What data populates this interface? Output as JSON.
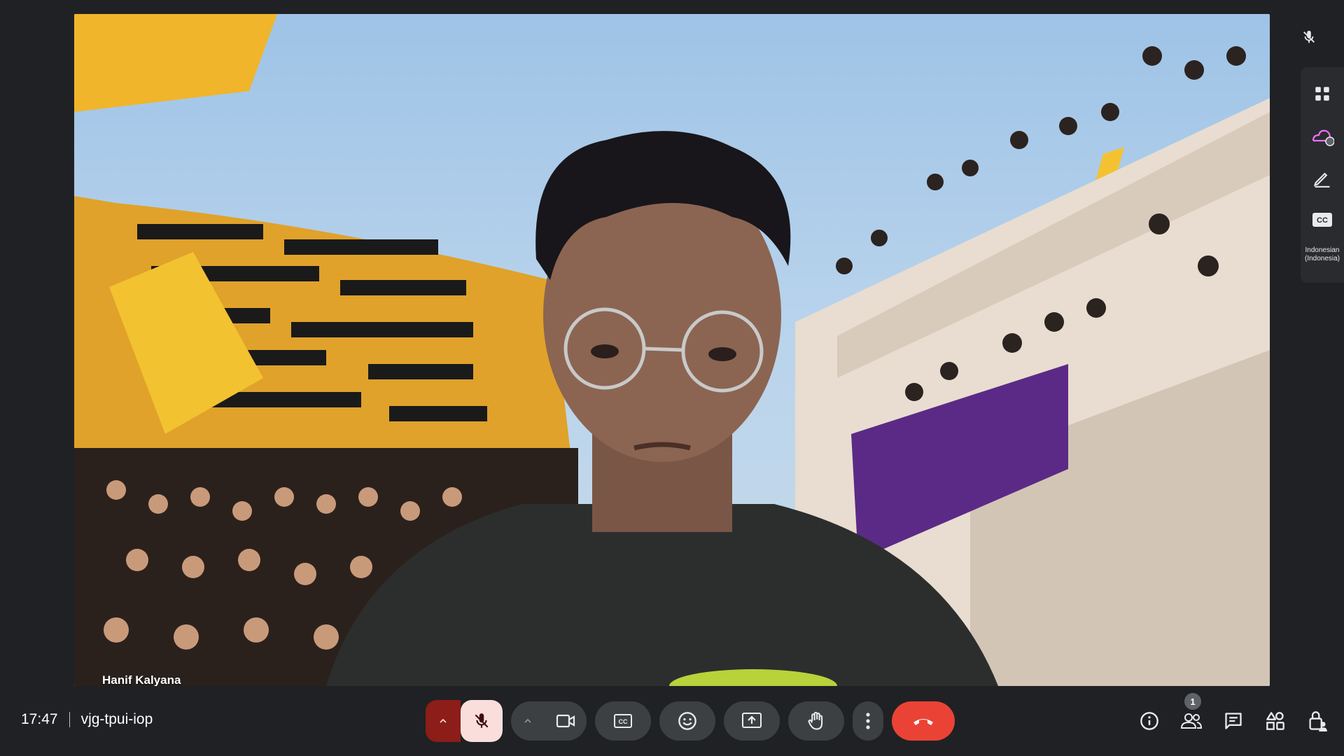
{
  "participant": {
    "name": "Hanif Kalyana"
  },
  "meeting": {
    "time": "17:47",
    "code": "vjg-tpui-iop"
  },
  "side_rail": {
    "items": [
      {
        "icon": "apps-grid-icon"
      },
      {
        "icon": "background-effects-icon"
      },
      {
        "icon": "pen-annotate-icon"
      },
      {
        "icon": "captions-cc-icon",
        "label": "CC"
      }
    ],
    "caption_language": "Indonesian (Indonesia)"
  },
  "controls": {
    "mic_muted": true,
    "camera_on": true,
    "colors": {
      "end_call": "#ea4335",
      "mic_muted_bg": "#f9dedc",
      "mic_caret_bg": "#8c1d18"
    }
  },
  "people": {
    "count": "1"
  }
}
